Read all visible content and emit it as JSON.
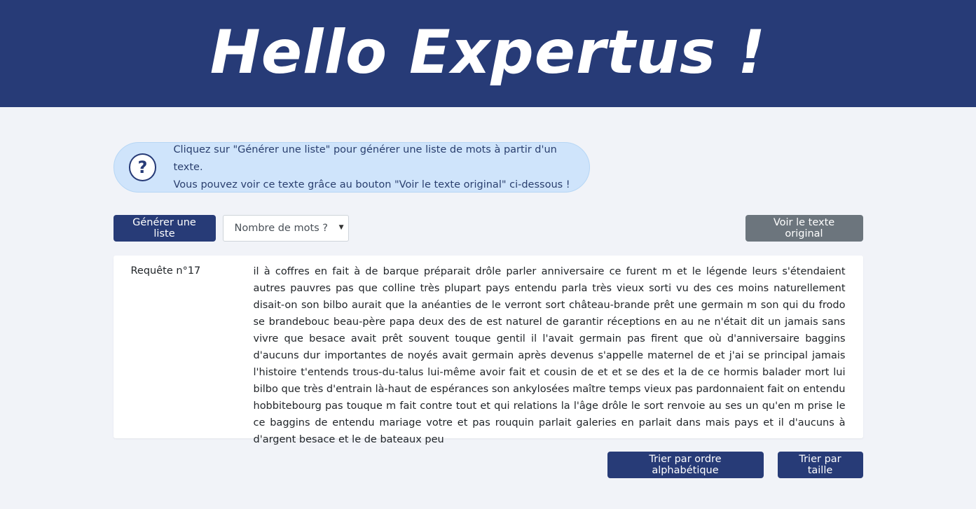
{
  "header": {
    "title": "Hello Expertus !"
  },
  "info": {
    "icon": "question-circle-icon",
    "line1": "Cliquez sur \"Générer une liste\" pour générer une liste de mots à partir d'un texte.",
    "line2": "Vous pouvez voir ce texte grâce au bouton \"Voir le texte original\" ci-dessous !"
  },
  "controls": {
    "generate_label": "Générer une liste",
    "select_value": "Nombre de mots ?",
    "original_label": "Voir le texte original"
  },
  "result": {
    "label": "Requête n°17",
    "text": "il à coffres en fait à de barque préparait drôle parler anniversaire ce furent m et le légende leurs s'étendaient autres pauvres pas que colline très plupart pays entendu parla très vieux sorti vu des ces moins naturellement disait-on son bilbo aurait que la anéanties de le verront sort château-brande prêt une germain m son qui du frodo se brandebouc beau-père papa deux des de est naturel de garantir réceptions en au ne n'était dit un jamais sans vivre que besace avait prêt souvent touque gentil il l'avait germain pas firent que où d'anniversaire baggins d'aucuns dur importantes de noyés avait germain après devenus s'appelle maternel de et j'ai se principal jamais l'histoire t'entends trous-du-talus lui-même avoir fait et cousin de et et se des et la de ce hormis balader mort lui bilbo que très d'entrain là-haut de espérances son ankylosées maître temps vieux pas pardonnaient fait on entendu hobbitebourg pas touque m fait contre tout et qui relations la l'âge drôle le sort renvoie au ses un qu'en m prise le ce baggins de entendu mariage votre et pas rouquin parlait galeries en parlait dans mais pays et il d'aucuns à d'argent besace et le de bateaux peu"
  },
  "sort": {
    "alpha_label": "Trier par ordre alphabétique",
    "size_label": "Trier par taille"
  }
}
